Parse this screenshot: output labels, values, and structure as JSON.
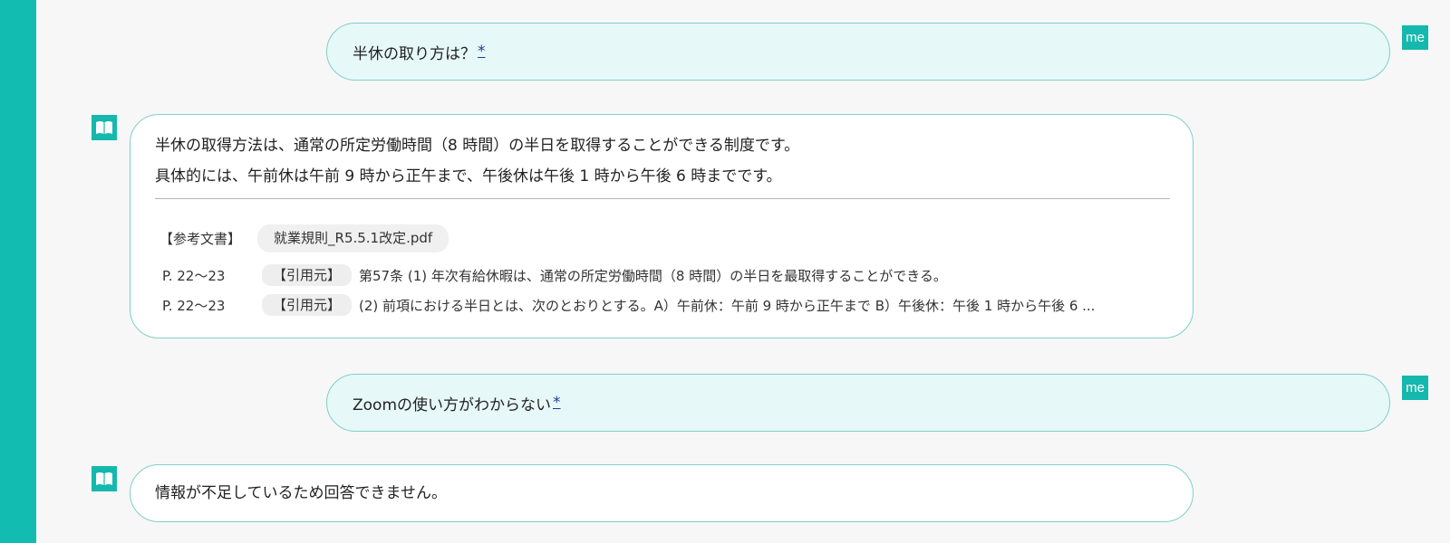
{
  "messages": [
    {
      "role": "user",
      "avatar_label": "me",
      "text": "半休の取り方は？",
      "link": "*"
    },
    {
      "role": "bot",
      "avatar_icon": "book-icon",
      "lines": [
        "半休の取得方法は、通常の所定労働時間（8 時間）の半日を取得することができる制度です。",
        "具体的には、午前休は午前 9 時から正午まで、午後休は午後 1 時から午後 6 時までです。"
      ],
      "references": {
        "label": "【参考文書】",
        "document": "就業規則_R5.5.1改定.pdf",
        "citations": [
          {
            "page": "P. 22～23",
            "tag": "【引用元】",
            "text": "第57条 (1) 年次有給休暇は、通常の所定労働時間（8 時間）の半日を最取得することができる。"
          },
          {
            "page": "P. 22～23",
            "tag": "【引用元】",
            "text": "(2) 前項における半日とは、次のとおりとする。A）午前休：午前 9 時から正午まで B）午後休：午後 1 時から午後 6 ..."
          }
        ]
      }
    },
    {
      "role": "user",
      "avatar_label": "me",
      "text": "Zoomの使い方がわからない",
      "link": "*"
    },
    {
      "role": "bot",
      "avatar_icon": "book-icon",
      "lines": [
        "情報が不足しているため回答できません。"
      ]
    }
  ],
  "colors": {
    "accent": "#12bcb0",
    "user_bubble_bg": "#e6f8f8",
    "bubble_border": "#7fd0c8",
    "link": "#1a3a9a"
  }
}
